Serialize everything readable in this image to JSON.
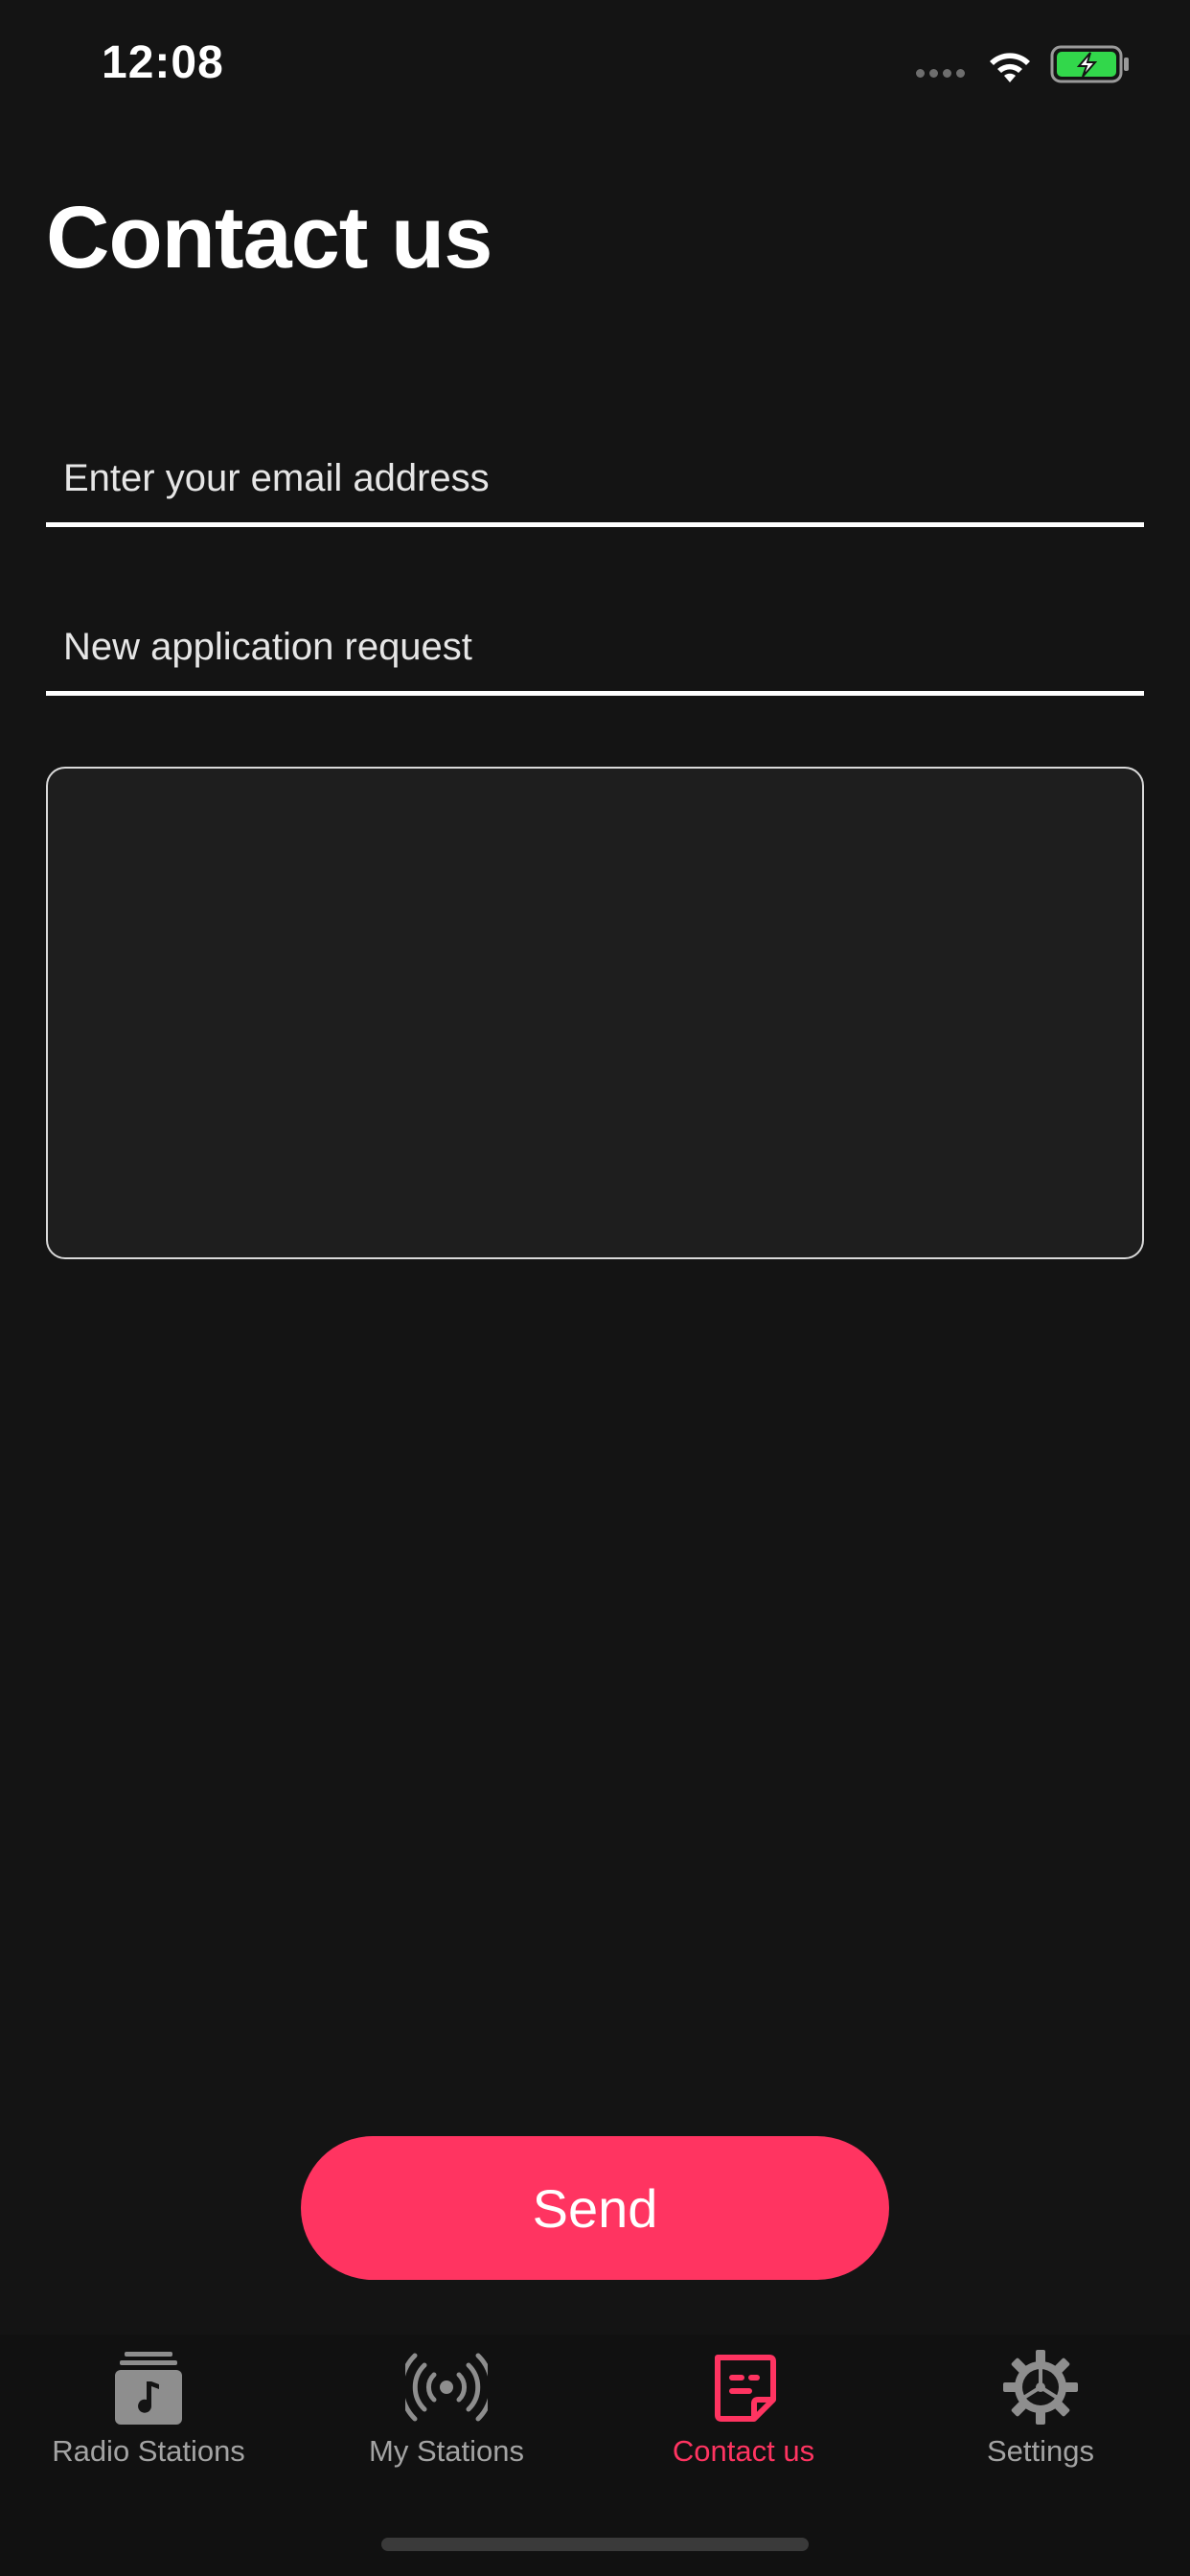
{
  "status_bar": {
    "time": "12:08",
    "icons": [
      "signal-dots-icon",
      "wifi-icon",
      "battery-charging-icon"
    ],
    "battery_color": "#32d74b"
  },
  "page": {
    "title": "Contact us"
  },
  "form": {
    "email_placeholder": "Enter your email address",
    "subject_placeholder": "New application request",
    "message_value": "",
    "send_label": "Send"
  },
  "tab_bar": {
    "items": [
      {
        "label": "Radio Stations",
        "icon": "music-library-icon",
        "active": false
      },
      {
        "label": "My Stations",
        "icon": "broadcast-icon",
        "active": false
      },
      {
        "label": "Contact us",
        "icon": "note-icon",
        "active": true
      },
      {
        "label": "Settings",
        "icon": "gear-icon",
        "active": false
      }
    ]
  },
  "colors": {
    "background": "#141414",
    "accent": "#ff3461",
    "inactive_tab": "#8e8e8e"
  }
}
